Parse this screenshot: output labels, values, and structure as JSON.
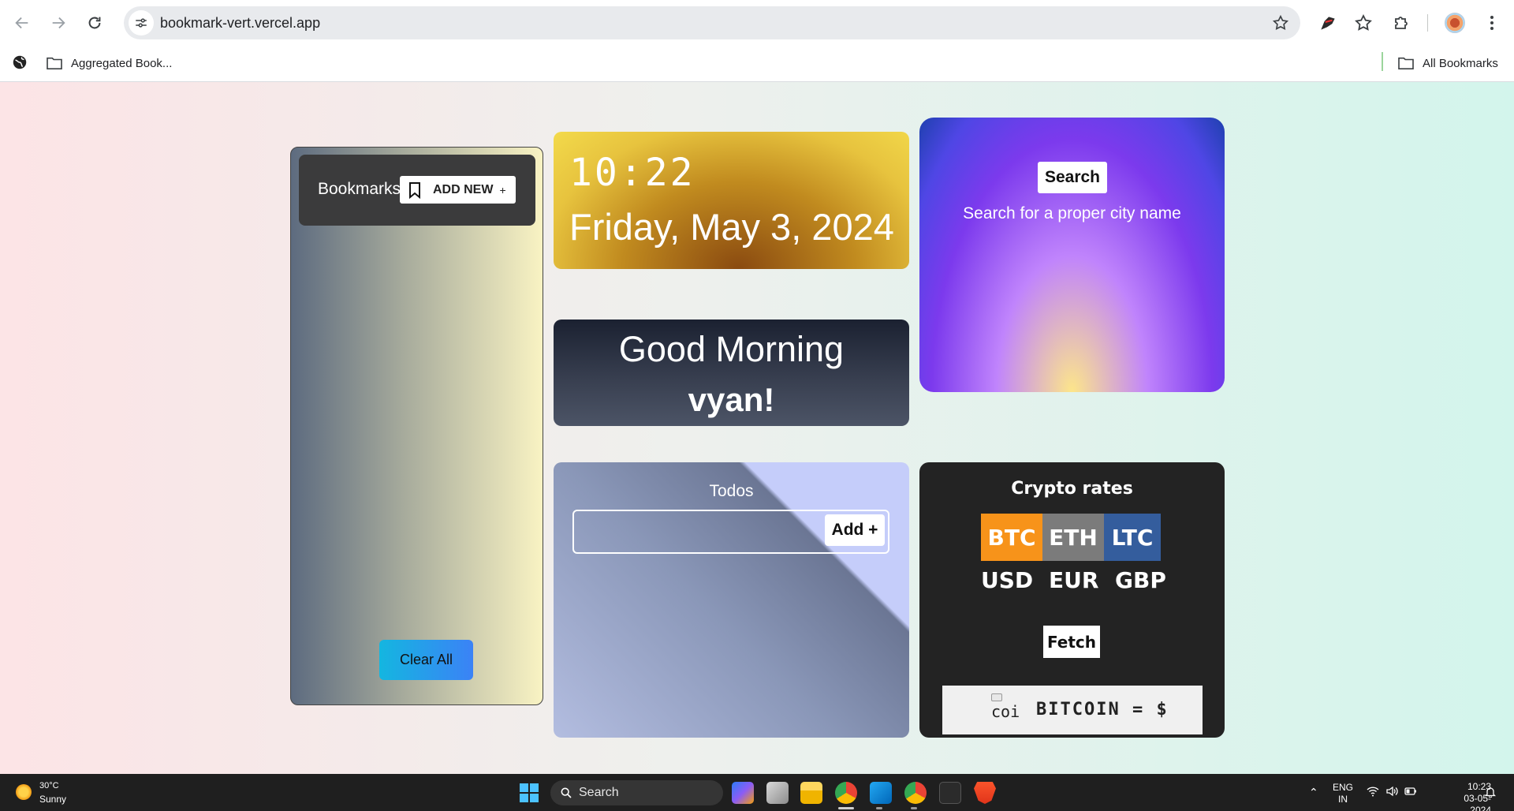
{
  "browser": {
    "url": "bookmark-vert.vercel.app",
    "bookmarks_bar": {
      "folder_left": "Aggregated Book...",
      "folder_right": "All Bookmarks"
    }
  },
  "bookmarks_panel": {
    "title": "Bookmarks",
    "add_new_label": "ADD NEW",
    "add_new_plus": "+",
    "clear_all_label": "Clear All"
  },
  "clock": {
    "time": "10:22",
    "date": "Friday, May 3, 2024"
  },
  "greeting": {
    "line": "Good Morning",
    "name": "vyan!"
  },
  "weather": {
    "search_label": "Search",
    "message": "Search for a proper city name"
  },
  "todos": {
    "title": "Todos",
    "input_value": "",
    "add_label": "Add +"
  },
  "crypto": {
    "title": "Crypto rates",
    "coins": [
      {
        "label": "BTC",
        "color": "#f7931a"
      },
      {
        "label": "ETH",
        "color": "#7b7b7b"
      },
      {
        "label": "LTC",
        "color": "#345d9d"
      }
    ],
    "currencies": [
      "USD",
      "EUR",
      "GBP"
    ],
    "fetch_label": "Fetch",
    "result_img_alt": "coi",
    "result_text": "BITCOIN = $"
  },
  "taskbar": {
    "weather_temp": "30°C",
    "weather_condition": "Sunny",
    "search_label": "Search",
    "lang_primary": "ENG",
    "lang_secondary": "IN",
    "time": "10:23",
    "date": "03-05-2024"
  }
}
